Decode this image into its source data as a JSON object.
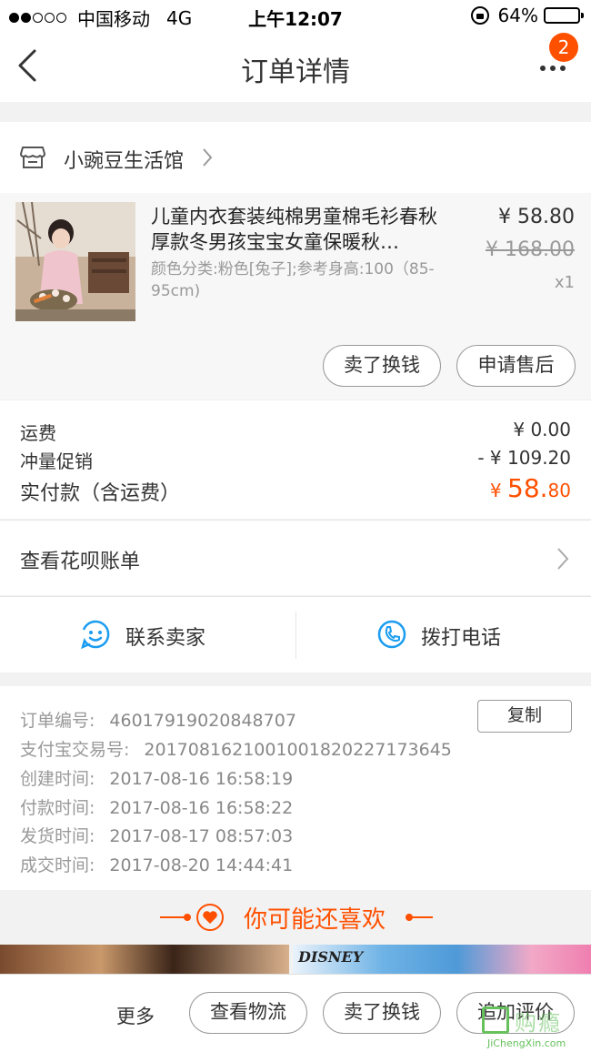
{
  "status_bar": {
    "carrier": "中国移动",
    "network": "4G",
    "time": "上午12:07",
    "battery": "64%",
    "battery_level": 0.64
  },
  "nav": {
    "title": "订单详情",
    "badge_count": "2"
  },
  "shop": {
    "name": "小豌豆生活馆"
  },
  "product": {
    "title": "儿童内衣套装纯棉男童棉毛衫春秋厚款冬男孩宝宝女童保暖秋…",
    "sku": "颜色分类:粉色[兔子];参考身高:100（85-95cm)",
    "price": "¥ 58.80",
    "original_price": "¥ 168.00",
    "quantity": "x1",
    "buttons": {
      "exchange": "卖了换钱",
      "after_sale": "申请售后"
    }
  },
  "fees": {
    "shipping_label": "运费",
    "shipping_value": "¥ 0.00",
    "promo_label": "冲量促销",
    "promo_value": "- ¥ 109.20",
    "paid_label": "实付款（含运费）",
    "paid_currency": "¥ ",
    "paid_integer": "58.",
    "paid_decimal": "80"
  },
  "huabei": {
    "label": "查看花呗账单"
  },
  "contact": {
    "seller": "联系卖家",
    "phone": "拨打电话"
  },
  "order_info": {
    "copy_button": "复制",
    "rows": [
      {
        "label": "订单编号:",
        "value": "46017919020848707"
      },
      {
        "label": "支付宝交易号:",
        "value": "2017081621001001820227173645"
      },
      {
        "label": "创建时间:",
        "value": "2017-08-16 16:58:19"
      },
      {
        "label": "付款时间:",
        "value": "2017-08-16 16:58:22"
      },
      {
        "label": "发货时间:",
        "value": "2017-08-17 08:57:03"
      },
      {
        "label": "成交时间:",
        "value": "2017-08-20 14:44:41"
      }
    ]
  },
  "recommend": {
    "title": "你可能还喜欢",
    "brand_text": "DISNEY"
  },
  "bottom_bar": {
    "more": "更多",
    "logistics": "查看物流",
    "exchange": "卖了换钱",
    "review": "追加评价"
  },
  "watermark": {
    "cn": "购瘾",
    "en": "JiChengXin.com"
  },
  "colors": {
    "accent": "#ff5000",
    "contact_icon": "#1a9cf0",
    "watermark": "#66c15c"
  }
}
